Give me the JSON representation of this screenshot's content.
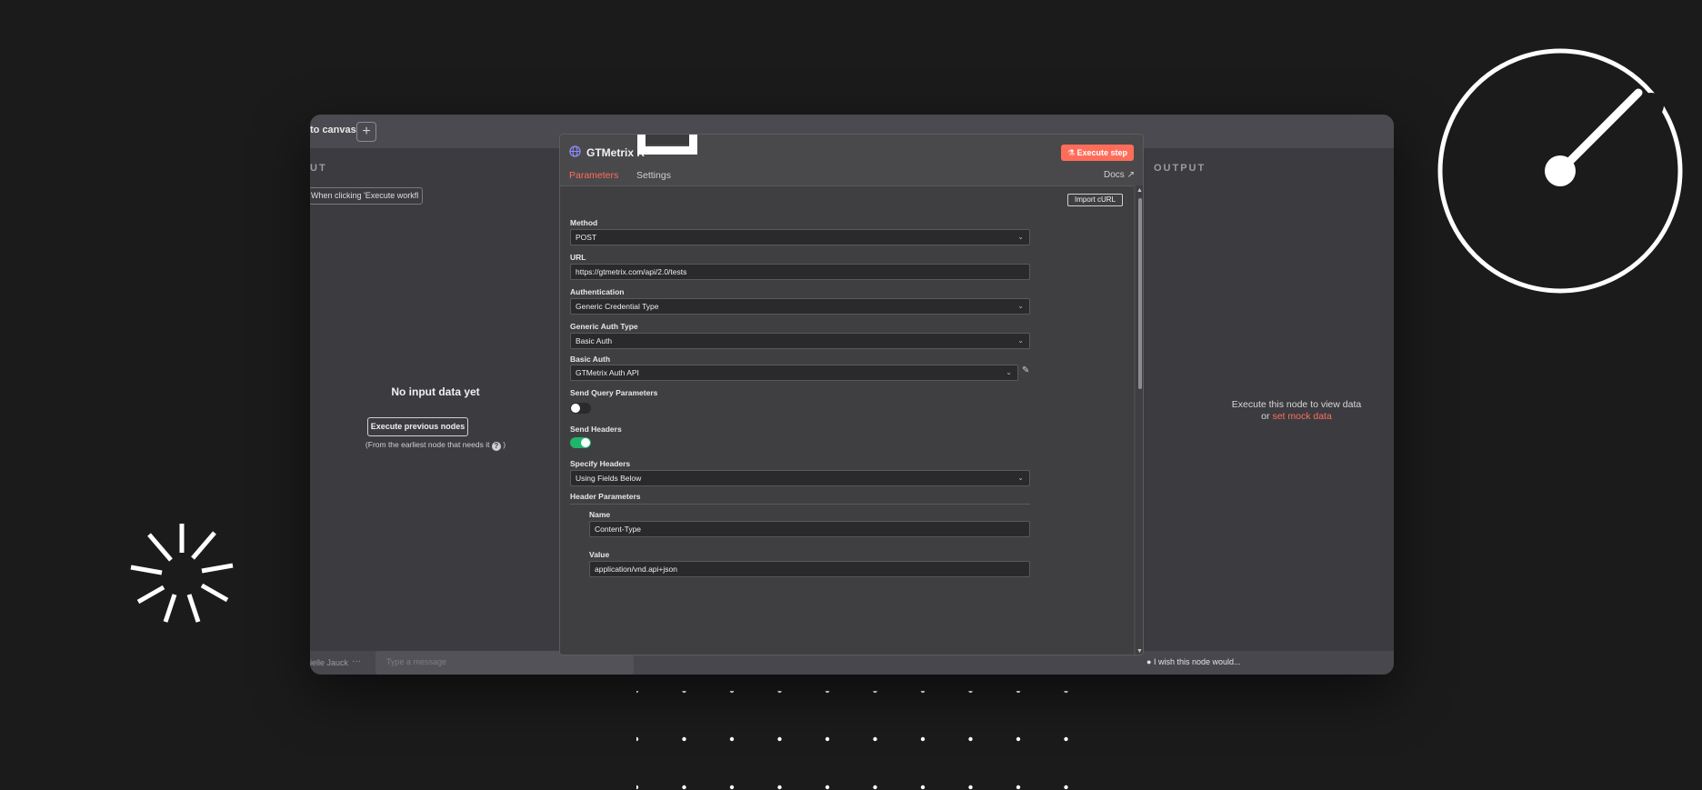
{
  "canvas": {
    "back_label": "to canvas",
    "add_label": "+"
  },
  "input_panel": {
    "title": "UT",
    "trigger_select": "When clicking 'Execute workfl",
    "empty_title": "No input data yet",
    "execute_previous": "Execute previous nodes",
    "earliest_note": "(From the earliest node that needs it",
    "help_glyph": "?",
    "earliest_close": ")"
  },
  "output_panel": {
    "title": "OUTPUT",
    "message": "Execute this node to view data",
    "or_text": "or",
    "mock_link": "set mock data"
  },
  "bottom": {
    "user": "ielle Jauck",
    "more": "···",
    "message_placeholder": "Type a message",
    "feedback": "I wish this node would..."
  },
  "node": {
    "title": "GTMetrix R",
    "execute_step": "Execute step",
    "tabs": [
      "Parameters",
      "Settings"
    ],
    "docs": "Docs",
    "import_curl": "Import cURL",
    "method_label": "Method",
    "method_value": "POST",
    "url_label": "URL",
    "url_value": "https://gtmetrix.com/api/2.0/tests",
    "auth_label": "Authentication",
    "auth_value": "Generic Credential Type",
    "generic_auth_label": "Generic Auth Type",
    "generic_auth_value": "Basic Auth",
    "basic_auth_label": "Basic Auth",
    "basic_auth_value": "GTMetrix Auth API",
    "send_query_label": "Send Query Parameters",
    "send_query_on": false,
    "send_headers_label": "Send Headers",
    "send_headers_on": true,
    "specify_headers_label": "Specify Headers",
    "specify_headers_value": "Using Fields Below",
    "header_params_label": "Header Parameters",
    "header_name_label": "Name",
    "header_name_value": "Content-Type",
    "header_value_label": "Value",
    "header_value_value": "application/vnd.api+json"
  },
  "colors": {
    "accent": "#ff6d5a",
    "toggle_on": "#20b56c",
    "toggle_off": "#2a2a2c",
    "background": "#1b1b1b"
  }
}
